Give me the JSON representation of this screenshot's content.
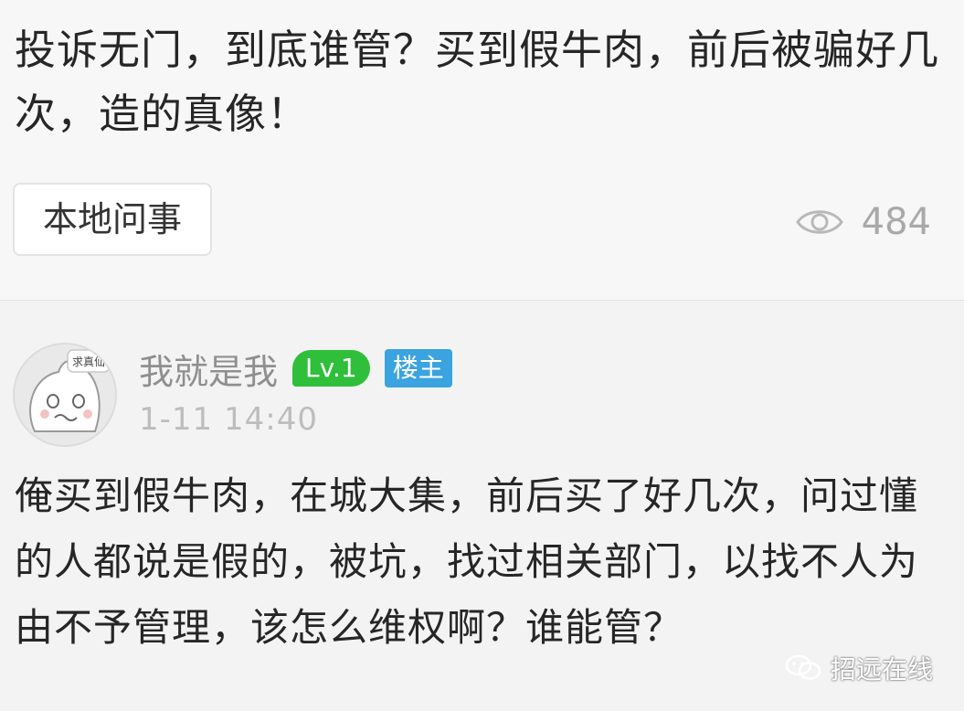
{
  "post": {
    "title": "投诉无门，到底谁管？买到假牛肉，前后被骗好几次，造的真像！",
    "tag": "本地问事",
    "view_count": "484",
    "icons": {
      "views": "eye-icon"
    }
  },
  "comment": {
    "author": {
      "name": "我就是我",
      "level_badge": "Lv.1",
      "role_badge": "楼主",
      "avatar_caption": "求真仙"
    },
    "time": "1-11 14:40",
    "body": "俺买到假牛肉，在城大集，前后买了好几次，问过懂的人都说是假的，被坑，找过相关部门，以找不人为由不予管理，该怎么维权啊？谁能管？"
  },
  "watermark": {
    "text": "招远在线",
    "icon": "wechat-icon"
  },
  "colors": {
    "level_badge": "#2fbf3a",
    "role_badge": "#3aa3e0",
    "muted_text": "#a9a9a9"
  }
}
